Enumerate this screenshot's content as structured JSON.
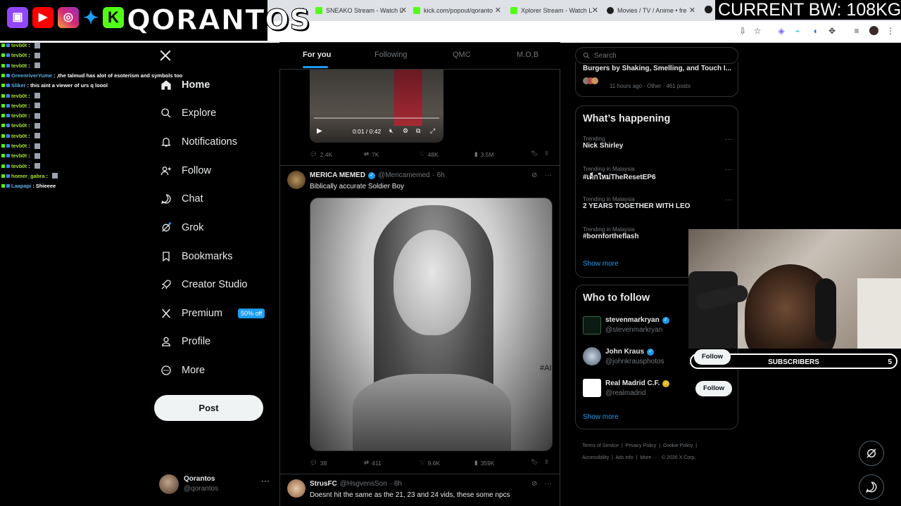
{
  "browser": {
    "tabs": [
      {
        "title": "SNEAKO Stream - Watch L",
        "icon_color": "#53fc18"
      },
      {
        "title": "kick.com/popout/qoranto",
        "icon_color": "#53fc18"
      },
      {
        "title": "Xplorer Stream - Watch L",
        "icon_color": "#53fc18"
      },
      {
        "title": "Movies / TV / Anime • fre",
        "icon_color": "#1e1e1e"
      }
    ]
  },
  "overlay": {
    "brand": "QORANTOS",
    "social_icons": [
      "twitch-icon",
      "youtube-icon",
      "instagram-icon",
      "twitter-icon",
      "kick-icon"
    ],
    "bandwidth": "CURRENT BW: 108KG",
    "subscribers_label": "SUBSCRIBERS",
    "subscribers_count": "5"
  },
  "chat": [
    {
      "user": "tevb0t",
      "msg": "",
      "color": "#a6e22e"
    },
    {
      "user": "tevb0t",
      "msg": "",
      "color": "#a6e22e"
    },
    {
      "user": "tevb0t",
      "msg": "",
      "color": "#a6e22e"
    },
    {
      "user": "GreenriverYume",
      "msg": " ,the talmud has alot of esoterism and symbols too",
      "color": "#5dade2"
    },
    {
      "user": "Sliker",
      "msg": " this aint a viewer of urs q loool",
      "color": "#5dade2"
    },
    {
      "user": "tevb0t",
      "msg": "",
      "color": "#a6e22e"
    },
    {
      "user": "tevb0t",
      "msg": "",
      "color": "#a6e22e"
    },
    {
      "user": "tevb0t",
      "msg": "",
      "color": "#a6e22e"
    },
    {
      "user": "tevb0t",
      "msg": "",
      "color": "#a6e22e"
    },
    {
      "user": "tevb0t",
      "msg": "",
      "color": "#a6e22e"
    },
    {
      "user": "tevb0t",
      "msg": "",
      "color": "#a6e22e"
    },
    {
      "user": "tevb0t",
      "msg": "",
      "color": "#a6e22e"
    },
    {
      "user": "tevb0t",
      "msg": "",
      "color": "#a6e22e"
    },
    {
      "user": "homer_gabra",
      "msg": "",
      "color": "#a6e22e"
    },
    {
      "user": "Laapapi",
      "msg": " Shieeee",
      "color": "#5dade2"
    }
  ],
  "nav": {
    "items": [
      {
        "label": "Home",
        "icon": "home-icon"
      },
      {
        "label": "Explore",
        "icon": "search-icon"
      },
      {
        "label": "Notifications",
        "icon": "bell-icon"
      },
      {
        "label": "Follow",
        "icon": "follow-icon"
      },
      {
        "label": "Chat",
        "icon": "chat-icon"
      },
      {
        "label": "Grok",
        "icon": "grok-icon"
      },
      {
        "label": "Bookmarks",
        "icon": "bookmark-icon"
      },
      {
        "label": "Creator Studio",
        "icon": "rocket-icon"
      },
      {
        "label": "Premium",
        "icon": "x-icon"
      },
      {
        "label": "Profile",
        "icon": "person-icon"
      },
      {
        "label": "More",
        "icon": "more-circle-icon"
      }
    ],
    "premium_badge": "50% off",
    "post_button": "Post",
    "profile_name": "Qorantos",
    "profile_handle": "@qorantos"
  },
  "feed": {
    "tabs": [
      "For you",
      "Following",
      "QMC",
      "M.O.B"
    ],
    "video_time": "0:01 / 0:42",
    "post1_stats": {
      "replies": "2.4K",
      "reposts": "7K",
      "likes": "48K",
      "views": "3.5M"
    },
    "post2": {
      "name": "MERICA MEMED",
      "handle": "@Mericamemed",
      "time": "· 6h",
      "text": "Biblically accurate Soldier Boy",
      "watermark": "#AI",
      "stats": {
        "replies": "38",
        "reposts": "411",
        "likes": "9.6K",
        "views": "359K"
      }
    },
    "post3": {
      "name": "StrusFC",
      "handle": "@HsgvensSon",
      "time": "· 8h",
      "text": "Doesnt hit the same as the 21, 23 and 24 vids, these some npcs"
    }
  },
  "right": {
    "search_placeholder": "Search",
    "prev_title": "Burgers by Shaking, Smelling, and Touch I...",
    "prev_meta": "11 hours ago · Other · 461 posts",
    "whats_happening": "What’s happening",
    "trends": [
      {
        "meta": "Trending",
        "name": "Nick Shirley"
      },
      {
        "meta": "Trending in Malaysia",
        "name": "#เด็กใหม่TheResetEP6"
      },
      {
        "meta": "Trending in Malaysia",
        "name": "2 YEARS TOGETHER WITH LEO"
      },
      {
        "meta": "Trending in Malaysia",
        "name": "#bornfortheflash"
      }
    ],
    "show_more": "Show more",
    "who_to_follow": "Who to follow",
    "accounts": [
      {
        "name": "stevenmarkryan",
        "handle": "@stevenmarkryan",
        "badge_color": "#1d9bf0"
      },
      {
        "name": "John Kraus",
        "handle": "@johnkrausphotos",
        "badge_color": "#1d9bf0"
      },
      {
        "name": "Real Madrid C.F.",
        "handle": "@realmadrid",
        "badge_color": "#e2b719"
      }
    ],
    "follow_label": "Follow",
    "footer_links": [
      "Terms of Service",
      "Privacy Policy",
      "Cookie Policy",
      "Accessibility",
      "Ads info",
      "More ···",
      "© 2026 X Corp."
    ]
  },
  "colors": {
    "accent": "#1d9bf0",
    "border": "#2f3336",
    "muted": "#71767b"
  }
}
